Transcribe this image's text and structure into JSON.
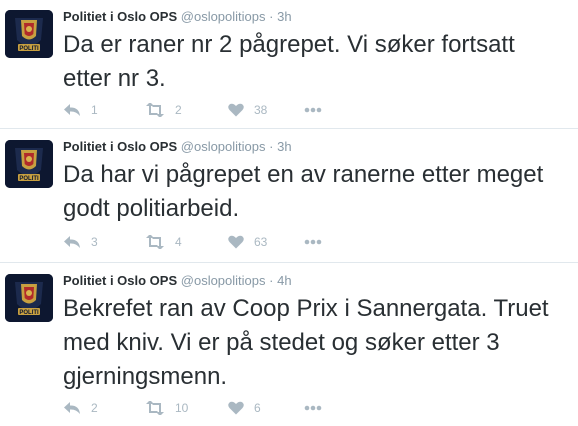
{
  "tweets": [
    {
      "name": "Politiet i Oslo OPS",
      "handle": "@oslopolitiops",
      "dot": "·",
      "time": "3h",
      "text": "Da er raner nr 2 pågrepet. Vi søker fortsatt etter nr 3.",
      "replies": "1",
      "retweets": "2",
      "likes": "38"
    },
    {
      "name": "Politiet i Oslo OPS",
      "handle": "@oslopolitiops",
      "dot": "·",
      "time": "3h",
      "text": "Da har vi pågrepet en av ranerne etter meget godt politiarbeid.",
      "replies": "3",
      "retweets": "4",
      "likes": "63"
    },
    {
      "name": "Politiet i Oslo OPS",
      "handle": "@oslopolitiops",
      "dot": "·",
      "time": "4h",
      "text": "Bekrefet ran av Coop Prix i Sannergata. Truet med kniv. Vi er på stedet og søker etter 3 gjerningsmenn.",
      "replies": "2",
      "retweets": "10",
      "likes": "6"
    }
  ],
  "avatar": {
    "badge_text": "POLITI",
    "badge_color": "#c8a040",
    "background": "#0d1730"
  },
  "colors": {
    "text": "#292f33",
    "muted": "#8899a6",
    "icon": "#aab8c2",
    "divider": "#e1e8ed"
  },
  "icons": {
    "reply": "reply-icon",
    "retweet": "retweet-icon",
    "like": "heart-icon",
    "more": "more-icon"
  }
}
